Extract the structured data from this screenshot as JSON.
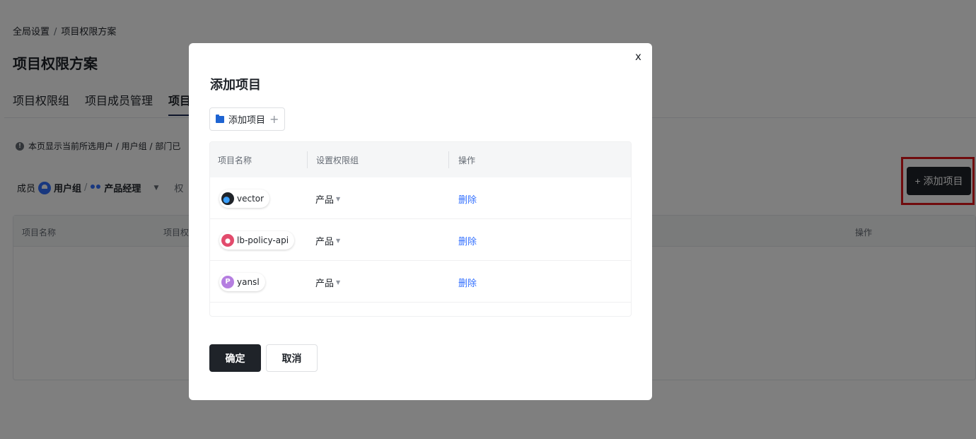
{
  "breadcrumb": {
    "root": "全局设置",
    "separator": "/",
    "current": "项目权限方案"
  },
  "page": {
    "title": "项目权限方案"
  },
  "tabs": [
    {
      "label": "项目权限组",
      "active": false
    },
    {
      "label": "项目成员管理",
      "active": false
    },
    {
      "label": "项目管",
      "active": true
    }
  ],
  "notice": {
    "icon": "info-icon",
    "text": "本页显示当前所选用户 / 用户组 / 部门已"
  },
  "filter": {
    "prefix": "成员",
    "group_icon": "user-group-icon",
    "group_label": "用户组",
    "separator": "/",
    "role_icon": "people-icon",
    "role_label": "产品经理",
    "arrow": "▼",
    "next_label": "权"
  },
  "add_project_button": {
    "icon": "plus-icon",
    "label": "+ 添加项目"
  },
  "background_table": {
    "columns": [
      "项目名称",
      "项目权",
      "操作"
    ]
  },
  "dialog": {
    "close_label": "x",
    "title": "添加项目",
    "add_toggle": {
      "icon": "folder-icon",
      "label": "添加项目",
      "plus": "+"
    },
    "columns": [
      "项目名称",
      "设置权限组",
      "操作"
    ],
    "rows": [
      {
        "name": "vector",
        "logo": "vector-logo-icon",
        "permission_group": "产品",
        "action": "删除"
      },
      {
        "name": "lb-policy-api",
        "logo": "lb-policy-api-logo-icon",
        "permission_group": "产品",
        "action": "删除"
      },
      {
        "name": "yansl",
        "logo": "yansl-logo-icon",
        "permission_group": "产品",
        "action": "删除"
      }
    ],
    "ok_label": "确定",
    "cancel_label": "取消"
  },
  "colors": {
    "primary_dark": "#1f2329",
    "link_blue": "#3370ff",
    "highlight_red": "#e0161b",
    "folder_blue": "#1e64d2"
  }
}
